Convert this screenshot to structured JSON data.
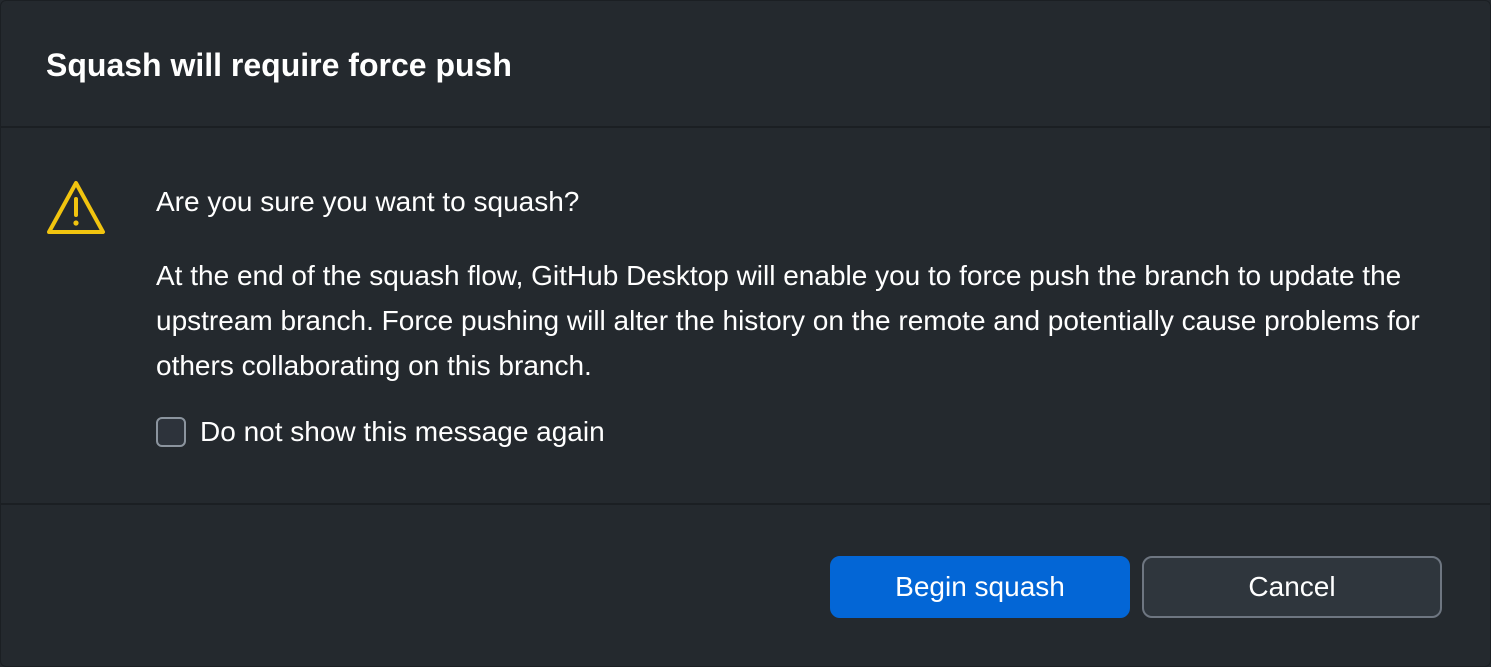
{
  "dialog": {
    "title": "Squash will require force push",
    "icon": "warning-triangle-icon",
    "question": "Are you sure you want to squash?",
    "description": "At the end of the squash flow, GitHub Desktop will enable you to force push the branch to update the upstream branch. Force pushing will alter the history on the remote and potentially cause problems for others collaborating on this branch.",
    "checkbox": {
      "label": "Do not show this message again",
      "checked": false
    },
    "buttons": {
      "primary_label": "Begin squash",
      "cancel_label": "Cancel"
    }
  },
  "colors": {
    "background": "#24292e",
    "warning": "#f1c40f",
    "primary_button": "#0366d6",
    "text": "#ffffff"
  }
}
